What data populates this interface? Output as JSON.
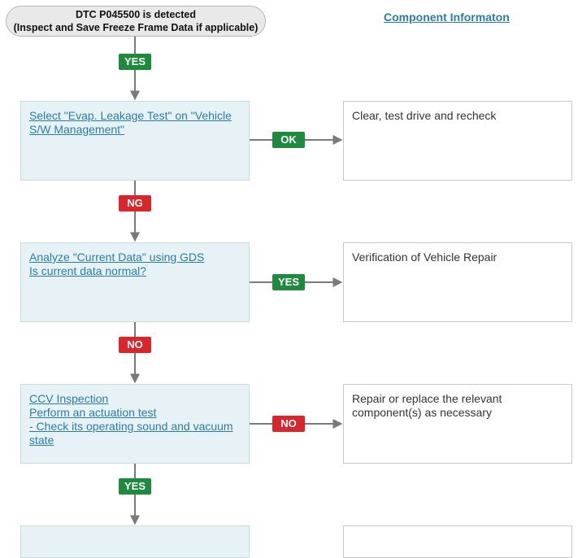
{
  "start": {
    "line1": "DTC P045500 is detected",
    "line2": "(Inspect and Save Freeze Frame Data if applicable)"
  },
  "component_link": "Component Informaton",
  "connectors": {
    "yes_top": "YES",
    "ng": "NG",
    "no_mid": "NO",
    "yes_bottom": "YES"
  },
  "steps": [
    {
      "lines": [
        "Select \"Evap. Leakage Test\" on \"Vehicle S/W Management\""
      ],
      "branch_label": "OK",
      "result": "Clear, test drive and recheck"
    },
    {
      "lines": [
        "Analyze \"Current Data\" using GDS",
        "Is current data normal?"
      ],
      "branch_label": "YES",
      "result": "Verification of Vehicle Repair"
    },
    {
      "lines": [
        "CCV Inspection",
        "Perform an actuation test",
        "- Check its operating sound and vacuum state"
      ],
      "branch_label": "NO",
      "result": "Repair or replace the relevant component(s) as necessary"
    }
  ],
  "colors": {
    "yes": "#1d8a3e",
    "no": "#d9262c",
    "link": "#2b7da4"
  }
}
